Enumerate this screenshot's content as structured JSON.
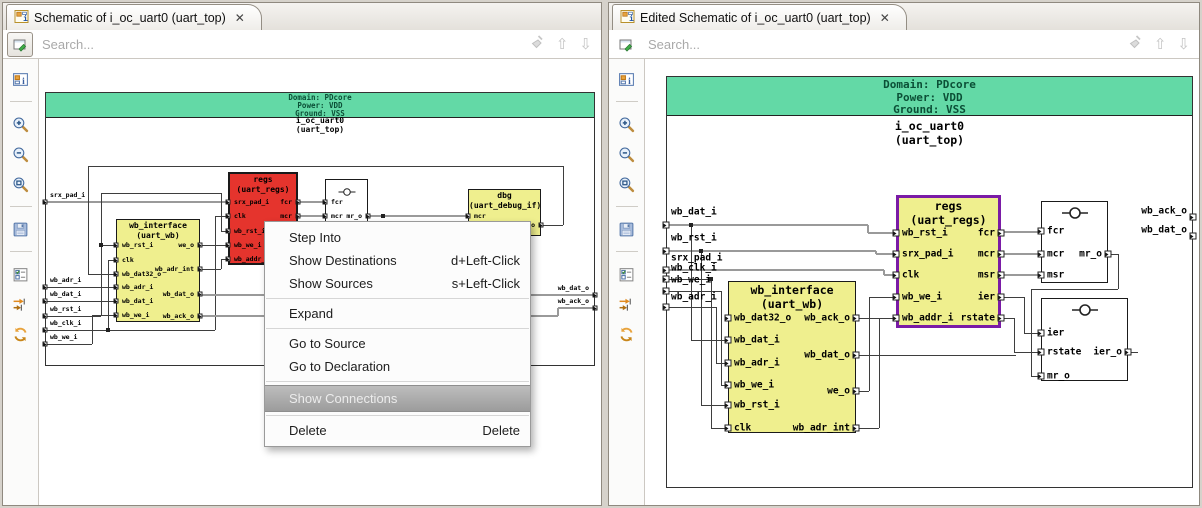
{
  "colors": {
    "header_green": "#63d9a6",
    "block_yellow": "#efef8e",
    "block_red": "#e5342d",
    "selection_purple": "#7a1ba6",
    "wire_gray": "#9a9a9a"
  },
  "icons": {
    "close": "✕",
    "search_prev": "⇧",
    "search_next": "⇩"
  },
  "left_panel": {
    "tab_title": "Schematic of i_oc_uart0 (uart_top)",
    "search_placeholder": "Search...",
    "toolbar_icons": [
      "overview",
      "zoom-in",
      "zoom-out",
      "zoom-fit",
      "save",
      "filter",
      "trace",
      "refresh"
    ],
    "schematic": {
      "header_lines": [
        "Domain: PDcore",
        "Power: VDD",
        "Ground: VSS"
      ],
      "instance_name": "i_oc_uart0",
      "module_name": "(uart_top)",
      "input_ports": [
        "srx_pad_i",
        "wb_adr_i",
        "wb_dat_i",
        "wb_rst_i",
        "wb_clk_i",
        "wb_we_i"
      ],
      "output_ports": [
        "wb_dat_o",
        "wb_ack_o"
      ],
      "blocks": [
        {
          "id": "wb_interface",
          "title": "wb_interface",
          "subtitle": "(uart_wb)",
          "style": "yellow",
          "left_ports": [
            "wb_rst_i",
            "clk",
            "wb_dat32_o",
            "wb_adr_i",
            "wb_dat_i",
            "wb_we_i"
          ],
          "right_ports": [
            "we_o",
            "wb_adr_int",
            "wb_dat_o",
            "wb_ack_o"
          ]
        },
        {
          "id": "regs",
          "title": "regs",
          "subtitle": "(uart_regs)",
          "style": "red",
          "left_ports": [
            "srx_pad_i",
            "clk",
            "wb_rst_i",
            "wb_we_i",
            "wb_addr_i"
          ],
          "right_ports": [
            "fcr",
            "mcr"
          ]
        },
        {
          "id": "ff1",
          "title": "",
          "subtitle": "",
          "style": "white",
          "glyph": "buffer",
          "left_ports": [
            "fcr",
            "mcr"
          ],
          "right_ports": [
            "mr_o"
          ]
        },
        {
          "id": "dbg",
          "title": "dbg",
          "subtitle": "(uart_debug_if)",
          "style": "yellow",
          "left_ports": [
            "mcr"
          ],
          "right_ports": [
            "_o"
          ]
        }
      ]
    },
    "context_menu": {
      "items": [
        {
          "label": "Step Into"
        },
        {
          "label": "Show Destinations",
          "shortcut": "d+Left-Click"
        },
        {
          "label": "Show Sources",
          "shortcut": "s+Left-Click"
        },
        {
          "separator": true
        },
        {
          "label": "Expand"
        },
        {
          "separator": true
        },
        {
          "label": "Go to Source"
        },
        {
          "label": "Go to Declaration"
        },
        {
          "separator": true
        },
        {
          "label": "Show Connections",
          "highlighted": true
        },
        {
          "separator": true
        },
        {
          "label": "Delete",
          "shortcut": "Delete"
        }
      ]
    }
  },
  "right_panel": {
    "tab_title": "Edited Schematic of i_oc_uart0 (uart_top)",
    "search_placeholder": "Search...",
    "toolbar_icons": [
      "overview",
      "zoom-in",
      "zoom-out",
      "zoom-fit",
      "save",
      "filter",
      "trace",
      "refresh"
    ],
    "schematic": {
      "header_lines": [
        "Domain: PDcore",
        "Power: VDD",
        "Ground: VSS"
      ],
      "instance_name": "i_oc_uart0",
      "module_name": "(uart_top)",
      "input_ports": [
        "wb_dat_i",
        "wb_rst_i",
        "srx_pad_i",
        "wb_clk_i",
        "wb_we_i",
        "wb_adr_i"
      ],
      "output_ports": [
        "wb_ack_o",
        "wb_dat_o"
      ],
      "blocks": [
        {
          "id": "regs",
          "title": "regs",
          "subtitle": "(uart_regs)",
          "style": "yellow",
          "selected": true,
          "left_ports": [
            "wb_rst_i",
            "srx_pad_i",
            "clk",
            "wb_we_i",
            "wb_addr_i"
          ],
          "right_ports": [
            "fcr",
            "mcr",
            "msr",
            "ier",
            "rstate"
          ]
        },
        {
          "id": "wb_interface",
          "title": "wb_interface",
          "subtitle": "(uart_wb)",
          "style": "yellow",
          "left_ports": [
            "wb_dat32_o",
            "wb_dat_i",
            "wb_adr_i",
            "wb_we_i",
            "wb_rst_i",
            "clk"
          ],
          "right_ports": [
            "wb_ack_o",
            "wb_dat_o",
            "we_o",
            "wb_adr_int"
          ]
        },
        {
          "id": "ff1",
          "title": "",
          "subtitle": "",
          "style": "white",
          "glyph": "buffer",
          "left_ports": [
            "fcr",
            "mcr",
            "msr"
          ],
          "right_ports": [
            "mr_o"
          ]
        },
        {
          "id": "ff2",
          "title": "",
          "subtitle": "",
          "style": "white",
          "glyph": "buffer",
          "left_ports": [
            "ier",
            "rstate",
            "mr_o"
          ],
          "right_ports": [
            "ier_o"
          ]
        }
      ]
    }
  }
}
